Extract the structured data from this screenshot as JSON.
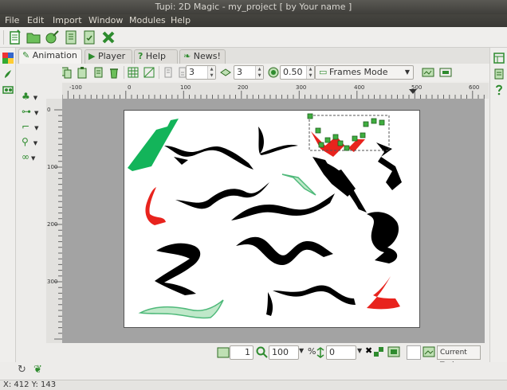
{
  "window": {
    "title": "Tupi: 2D Magic - my_project [ by Your name ]"
  },
  "menu": [
    "File",
    "Edit",
    "Import",
    "Window",
    "Modules",
    "Help"
  ],
  "tabs": [
    "Animation",
    "Player",
    "Help",
    "News!"
  ],
  "anim_toolbar": {
    "spin_one": "3",
    "spin_two": "3",
    "opacity": "0.50",
    "mode": "Frames Mode"
  },
  "ruler": {
    "h_ticks": [
      "-100",
      "0",
      "100",
      "200",
      "300",
      "400",
      "500",
      "600"
    ],
    "v_ticks": [
      "0",
      "100",
      "200",
      "300"
    ]
  },
  "bottom_toolbar": {
    "frame": "1",
    "zoom": "100",
    "zoom_unit": "%",
    "rotation": "0",
    "current_tool_label": "Current Tool"
  },
  "status": {
    "coords": "X: 412 Y: 143"
  },
  "colors": {
    "accent_green": "#2e8b2e",
    "selection_red": "#e8231d"
  }
}
